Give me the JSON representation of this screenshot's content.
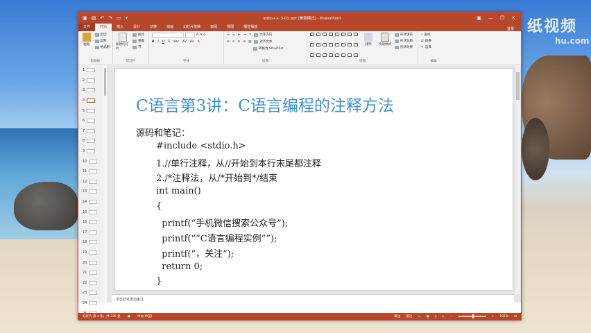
{
  "watermark": {
    "line1": "纸视频",
    "line2": "hu.com"
  },
  "window": {
    "title": "stdio++-3-01.ppt [兼容模式] - PowerPoint",
    "login": "登录"
  },
  "tabs": [
    "文件",
    "开始",
    "插入",
    "设计",
    "切换",
    "动画",
    "幻灯片放映",
    "审阅",
    "视图",
    "播音播放"
  ],
  "ribbon": {
    "clipboard": {
      "paste": "粘贴",
      "cut": "剪切",
      "copy": "复制",
      "format_painter": "格式刷",
      "label": "剪贴板"
    },
    "slides": {
      "new_slide": "新建幻灯片",
      "layout": "版式",
      "reset": "重置",
      "section": "节",
      "label": "幻灯片"
    },
    "font": {
      "label": "字体"
    },
    "paragraph": {
      "text_direction": "文字方向",
      "align_text": "对齐文本",
      "smartart": "转换为 SmartArt",
      "label": "段落"
    },
    "drawing": {
      "arrange": "排列",
      "quick_styles": "快速样式",
      "shape_fill": "形状填充",
      "shape_outline": "形状轮廓",
      "shape_effects": "形状效果",
      "label": "绘图"
    },
    "editing": {
      "find": "查找",
      "replace": "替换",
      "select": "选择",
      "label": "编辑"
    }
  },
  "thumbnails": [
    "1",
    "2",
    "3",
    "4",
    "5",
    "6",
    "7",
    "8",
    "9",
    "10",
    "11",
    "12",
    "13",
    "14",
    "15",
    "16",
    "17",
    "18",
    "19",
    "20",
    "21",
    "22",
    "23",
    "24",
    "25"
  ],
  "active_slide_index": 3,
  "slide": {
    "title": "C语言第3讲：C语言编程的注释方法",
    "subtitle": "源码和笔记：",
    "code_lines": [
      "#include <stdio.h>",
      "1.//单行注释，从//开始到本行末尾都注释",
      "2./*注释法，从/*开始到*/结束",
      "int main()",
      "{",
      "  printf(“手机微信搜索公众号”);",
      "  printf(““C语言编程实例””);",
      "  printf(“，关注”);",
      "  return 0;",
      "}"
    ]
  },
  "notes": {
    "placeholder": "单击此处添加备注"
  },
  "status": {
    "slide_info": "幻灯片 第 4 张，共 336 张",
    "language": "中文(中国)",
    "notes_btn": "备注",
    "comments_btn": "批注",
    "zoom": "101%"
  },
  "colors": {
    "accent": "#b7472a",
    "title_blue": "#3d8fd4"
  }
}
